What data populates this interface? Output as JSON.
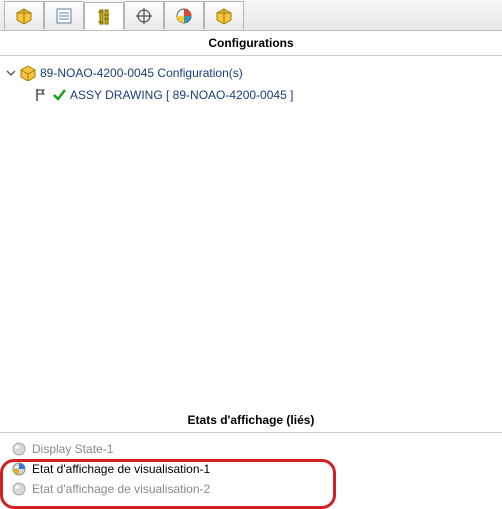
{
  "tabs": {
    "items": [
      {
        "name": "tab-feature-manager",
        "icon": "cube-yellow"
      },
      {
        "name": "tab-property",
        "icon": "list"
      },
      {
        "name": "tab-configuration",
        "icon": "config"
      },
      {
        "name": "tab-dim",
        "icon": "target"
      },
      {
        "name": "tab-appearance",
        "icon": "pie"
      },
      {
        "name": "tab-assembly",
        "icon": "cube-yellow"
      }
    ],
    "active": 2
  },
  "section_configurations": "Configurations",
  "config_tree": {
    "root": "89-NOAO-4200-0045 Configuration(s)",
    "child": "ASSY DRAWING [ 89-NOAO-4200-0045 ]"
  },
  "section_display_states": "Etats d'affichage (liés)",
  "display_states": [
    {
      "label": "Display State-1",
      "active": false
    },
    {
      "label": "Etat d'affichage de visualisation-1",
      "active": true
    },
    {
      "label": "Etat d'affichage de visualisation-2",
      "active": false
    }
  ]
}
